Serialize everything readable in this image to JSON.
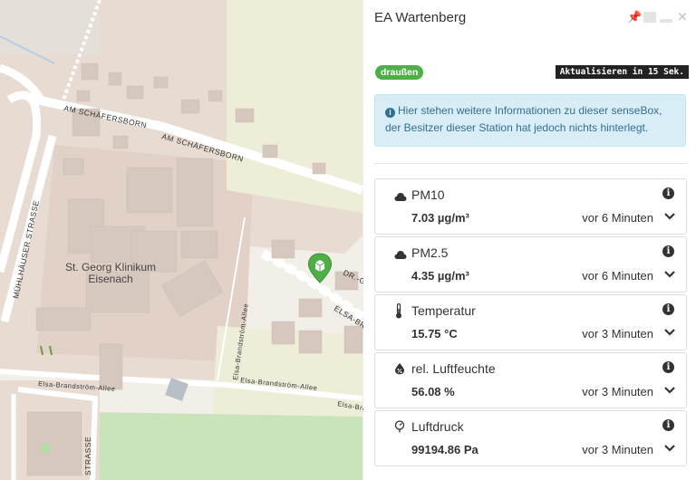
{
  "map": {
    "street_labels": {
      "am_schaefersborn_1": "AM SCHÄFERSBORN",
      "am_schaefersborn_2": "AM SCHÄFERSBORN",
      "muehlhaeuser": "MÜHLHÄUSER STRASSE",
      "dr_g": "DR.-G",
      "elsa_br": "ELSA-BR",
      "elsa_allee_1": "Elsa-Brandström-Allee",
      "elsa_allee_2": "Elsa-Brandström-Allee",
      "elsa_allee_3": "Elsa-Brandström-Allee",
      "elsa_allee_vert": "Elsa-Brandström-Allee",
      "strasse_bottom": "STRASSE"
    },
    "poi_label_line1": "St. Georg Klinikum",
    "poi_label_line2": "Eisenach",
    "marker_color": "#4eaf47"
  },
  "panel": {
    "title": "EA Wartenberg",
    "exposure_badge": "draußen",
    "refresh_text": "Aktualisieren in 15 Sek.",
    "info_text": "Hier stehen weitere Informationen zu dieser senseBox, der Besitzer dieser Station hat jedoch nichts hinterlegt.",
    "sensors": [
      {
        "name": "PM10",
        "value": "7.03 µg/m³",
        "time": "vor 6 Minuten",
        "icon": "cloud-icon"
      },
      {
        "name": "PM2.5",
        "value": "4.35 µg/m³",
        "time": "vor 6 Minuten",
        "icon": "cloud-icon"
      },
      {
        "name": "Temperatur",
        "value": "15.75 °C",
        "time": "vor 3 Minuten",
        "icon": "thermometer-icon"
      },
      {
        "name": "rel. Luftfeuchte",
        "value": "56.08 %",
        "time": "vor 3 Minuten",
        "icon": "humidity-icon"
      },
      {
        "name": "Luftdruck",
        "value": "99194.86 Pa",
        "time": "vor 3 Minuten",
        "icon": "pressure-icon"
      }
    ]
  },
  "colors": {
    "badge_green": "#4eaf47",
    "info_bg": "#d9edf7",
    "info_text": "#31708f"
  }
}
